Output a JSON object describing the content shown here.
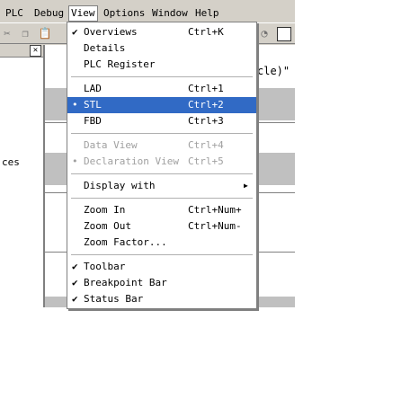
{
  "menubar": {
    "items": [
      {
        "label": "PLC",
        "key": "P"
      },
      {
        "label": "Debug",
        "key": "D"
      },
      {
        "label": "View",
        "key": "V"
      },
      {
        "label": "Options",
        "key": "O"
      },
      {
        "label": "Window",
        "key": "W"
      },
      {
        "label": "Help",
        "key": "H"
      }
    ]
  },
  "left_pane": {
    "text": "ces"
  },
  "editor": {
    "comment_fragment": "cle)\""
  },
  "view_menu": {
    "items": [
      {
        "label": "Overviews",
        "shortcut": "Ctrl+K",
        "checked": true
      },
      {
        "label": "Details",
        "shortcut": ""
      },
      {
        "label": "PLC Register",
        "shortcut": ""
      },
      {
        "label": "LAD",
        "shortcut": "Ctrl+1"
      },
      {
        "label": "STL",
        "shortcut": "Ctrl+2",
        "bullet": true,
        "selected": true
      },
      {
        "label": "FBD",
        "shortcut": "Ctrl+3"
      },
      {
        "label": "Data View",
        "shortcut": "Ctrl+4",
        "disabled": true
      },
      {
        "label": "Declaration View",
        "shortcut": "Ctrl+5",
        "disabled": true,
        "bullet": true
      },
      {
        "label": "Display with",
        "shortcut": "",
        "submenu": true
      },
      {
        "label": "Zoom In",
        "shortcut": "Ctrl+Num+"
      },
      {
        "label": "Zoom Out",
        "shortcut": "Ctrl+Num-"
      },
      {
        "label": "Zoom Factor...",
        "shortcut": ""
      },
      {
        "label": "Toolbar",
        "shortcut": "",
        "checked": true
      },
      {
        "label": "Breakpoint Bar",
        "shortcut": "",
        "checked": true
      },
      {
        "label": "Status Bar",
        "shortcut": "",
        "checked": true
      }
    ]
  }
}
